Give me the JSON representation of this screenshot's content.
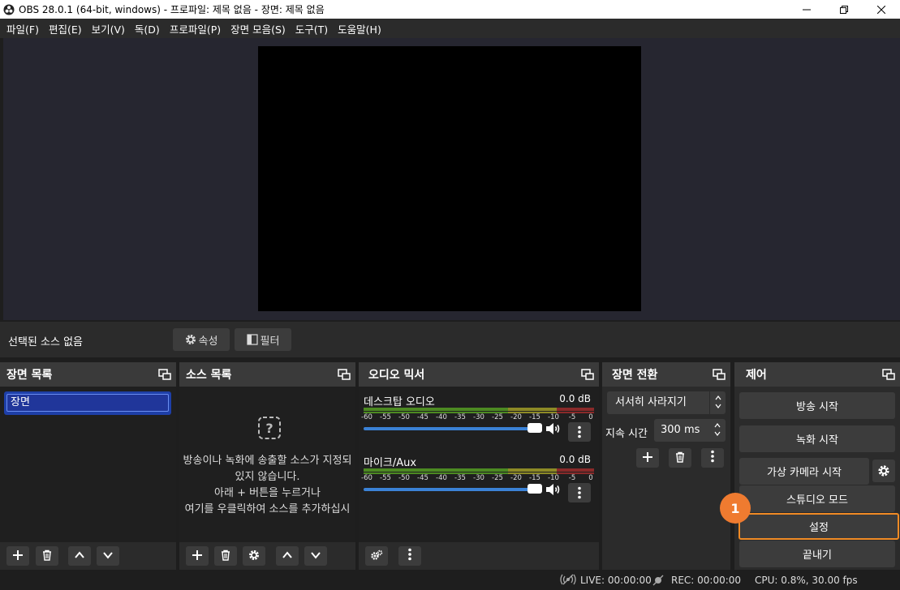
{
  "window": {
    "title": "OBS 28.0.1 (64-bit, windows) - 프로파일: 제목 없음 - 장면: 제목 없음",
    "minimize_icon": "minimize-icon",
    "maximize_icon": "restore-icon",
    "close_icon": "close-icon"
  },
  "menu": [
    "파일(F)",
    "편집(E)",
    "보기(V)",
    "독(D)",
    "프로파일(P)",
    "장면 모음(S)",
    "도구(T)",
    "도움말(H)"
  ],
  "context_bar": {
    "no_source": "선택된 소스 없음",
    "properties": "속성",
    "filters": "필터"
  },
  "scenes": {
    "title": "장면 목록",
    "items": [
      "장면"
    ]
  },
  "sources": {
    "title": "소스 목록",
    "empty_lines": [
      "방송이나 녹화에 송출할 소스가 지정되",
      "있지 않습니다.",
      "아래 + 버튼을 누르거나",
      "여기를 우클릭하여 소스를 추가하십시"
    ]
  },
  "mixer": {
    "title": "오디오 믹서",
    "scale": [
      "-60",
      "-55",
      "-50",
      "-45",
      "-40",
      "-35",
      "-30",
      "-25",
      "-20",
      "-15",
      "-10",
      "-5",
      "0"
    ],
    "channels": [
      {
        "name": "데스크탑 오디오",
        "db": "0.0 dB",
        "volume": 1.0
      },
      {
        "name": "마이크/Aux",
        "db": "0.0 dB",
        "volume": 1.0
      }
    ]
  },
  "transitions": {
    "title": "장면 전환",
    "selected": "서서히 사라지기",
    "duration_label": "지속 시간",
    "duration_value": "300 ms"
  },
  "controls": {
    "title": "제어",
    "start_streaming": "방송 시작",
    "start_recording": "녹화 시작",
    "start_virtual_camera": "가상 카메라 시작",
    "studio_mode": "스튜디오 모드",
    "settings": "설정",
    "exit": "끝내기",
    "badge": "1"
  },
  "status": {
    "live": "LIVE: 00:00:00",
    "rec": "REC: 00:00:00",
    "cpu": "CPU: 0.8%, 30.00 fps"
  },
  "colors": {
    "accent_badge": "#ef7b30",
    "highlight_border": "#f08a24",
    "scene_selected": "#1e3fa8",
    "volume_slider": "#3b82d6"
  }
}
